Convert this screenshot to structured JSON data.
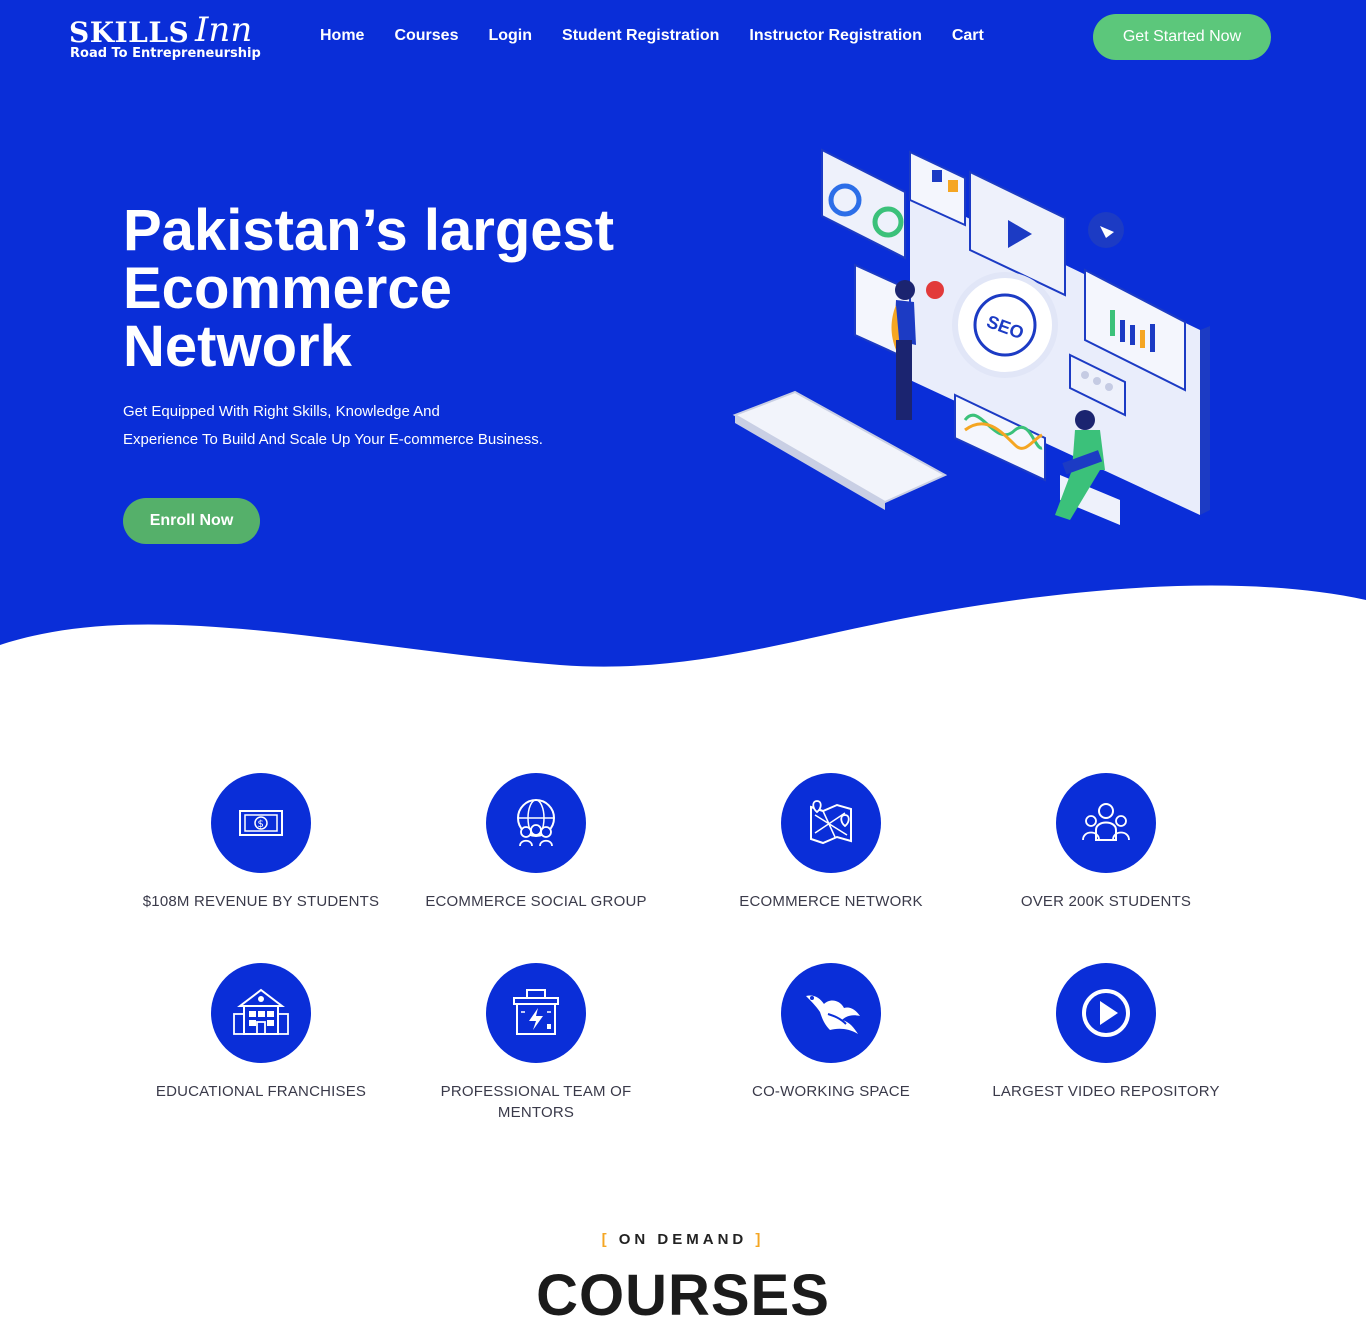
{
  "logo": {
    "brand": "SKILLS",
    "brand_script": "Inn",
    "tagline": "Road To Entrepreneurship"
  },
  "nav": {
    "items": [
      "Home",
      "Courses",
      "Login",
      "Student Registration",
      "Instructor Registration",
      "Cart"
    ]
  },
  "header": {
    "cta_label": "Get Started Now"
  },
  "hero": {
    "title_line1": "Pakistan’s largest",
    "title_line2": "Ecommerce",
    "title_line3": "Network",
    "subtitle_line1": "Get Equipped With Right Skills, Knowledge And",
    "subtitle_line2": "Experience To Build And Scale Up Your E-commerce Business.",
    "enroll_label": "Enroll Now",
    "illustration_text": "SEO"
  },
  "features": [
    {
      "icon": "money-icon",
      "label": "$108M REVENUE BY STUDENTS"
    },
    {
      "icon": "globe-people-icon",
      "label": "ECOMMERCE SOCIAL GROUP"
    },
    {
      "icon": "map-icon",
      "label": "ECOMMERCE NETWORK"
    },
    {
      "icon": "students-icon",
      "label": "OVER 200K STUDENTS"
    },
    {
      "icon": "building-icon",
      "label": "EDUCATIONAL FRANCHISES"
    },
    {
      "icon": "toolbox-icon",
      "label": "PROFESSIONAL TEAM OF MENTORS"
    },
    {
      "icon": "phoenix-icon",
      "label": "CO-WORKING SPACE"
    },
    {
      "icon": "play-icon",
      "label": "LARGEST VIDEO REPOSITORY"
    }
  ],
  "section": {
    "bracket_open": "[",
    "eyebrow": "ON DEMAND",
    "bracket_close": "]",
    "title": "COURSES"
  },
  "colors": {
    "primary_blue": "#0a2ed8",
    "green": "#5cc77b",
    "accent_orange": "#f5a623"
  }
}
